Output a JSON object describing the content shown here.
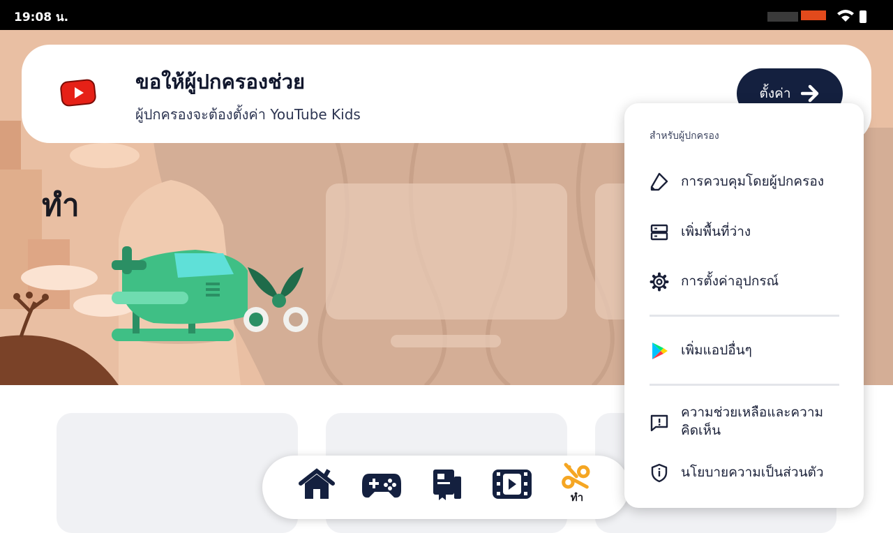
{
  "status_bar": {
    "time": "19:08 น."
  },
  "parent_banner": {
    "title": "ขอให้ผู้ปกครองช่วย",
    "subtitle": "ผู้ปกครองจะต้องตั้งค่า YouTube Kids",
    "setup_button": "ตั้งค่า"
  },
  "hero": {
    "title": "ทำ"
  },
  "bottom_nav": {
    "items": [
      {
        "icon": "home-icon"
      },
      {
        "icon": "gamepad-icon"
      },
      {
        "icon": "books-icon"
      },
      {
        "icon": "film-icon"
      },
      {
        "icon": "scissors-icon",
        "label": "ทำ",
        "active": true
      }
    ],
    "active_color": "#f5a623"
  },
  "menu": {
    "header": "สำหรับผู้ปกครอง",
    "items": [
      {
        "label": "การควบคุมโดยผู้ปกครอง",
        "icon": "pen-icon"
      },
      {
        "label": "เพิ่มพื้นที่ว่าง",
        "icon": "storage-icon"
      },
      {
        "label": "การตั้งค่าอุปกรณ์",
        "icon": "gear-icon"
      },
      {
        "label": "เพิ่มแอปอื่นๆ",
        "icon": "play-store-icon"
      },
      {
        "label_line1": "ความช่วยเหลือและความ",
        "label_line2": "คิดเห็น",
        "icon": "feedback-icon"
      },
      {
        "label": "นโยบายความเป็นส่วนตัว",
        "icon": "shield-icon"
      }
    ]
  },
  "colors": {
    "hero_background": "#e9bfa3",
    "dark_navy": "#14203f",
    "accent_orange": "#f5a623",
    "youtube_red": "#e62117"
  }
}
